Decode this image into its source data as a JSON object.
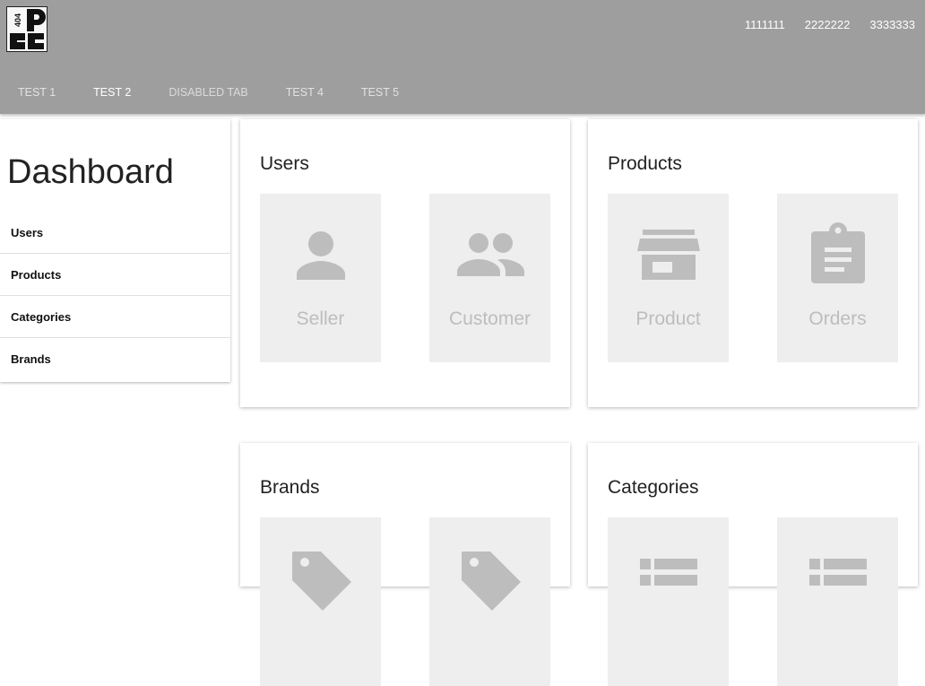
{
  "header": {
    "links": [
      "1111111",
      "2222222",
      "3333333"
    ]
  },
  "tabs": [
    {
      "label": "TEST 1"
    },
    {
      "label": "TEST 2"
    },
    {
      "label": "DISABLED TAB"
    },
    {
      "label": "TEST 4"
    },
    {
      "label": "TEST 5"
    }
  ],
  "sidebar": {
    "title": "Dashboard",
    "items": [
      {
        "label": "Users"
      },
      {
        "label": "Products"
      },
      {
        "label": "Categories"
      },
      {
        "label": "Brands"
      }
    ]
  },
  "cards": [
    {
      "title": "Users",
      "tiles": [
        {
          "label": "Seller",
          "icon": "person-icon"
        },
        {
          "label": "Customer",
          "icon": "people-icon"
        }
      ]
    },
    {
      "title": "Products",
      "tiles": [
        {
          "label": "Product",
          "icon": "store-icon"
        },
        {
          "label": "Orders",
          "icon": "clipboard-icon"
        }
      ]
    },
    {
      "title": "Brands",
      "tiles": [
        {
          "label": "",
          "icon": "tag-icon"
        },
        {
          "label": "",
          "icon": "tag-icon"
        }
      ]
    },
    {
      "title": "Categories",
      "tiles": [
        {
          "label": "",
          "icon": "category-icon"
        },
        {
          "label": "",
          "icon": "category-icon"
        }
      ]
    }
  ],
  "colors": {
    "header_bg": "#9e9e9e",
    "tile_bg": "#eeeeee",
    "tile_icon": "#bdbdbd"
  }
}
